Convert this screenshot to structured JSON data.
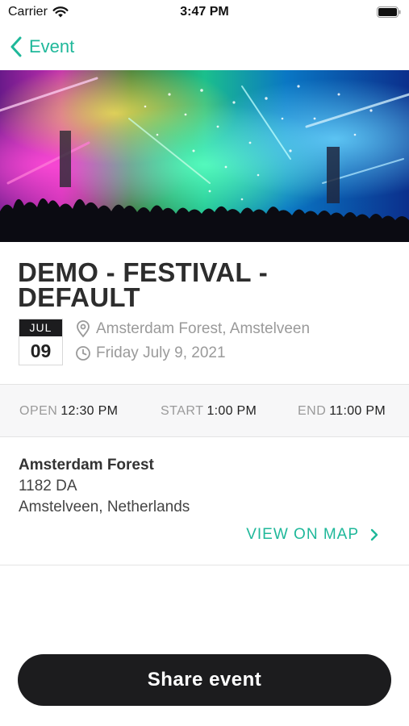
{
  "status_bar": {
    "carrier": "Carrier",
    "time": "3:47 PM"
  },
  "nav": {
    "back_label": "Event"
  },
  "event": {
    "title": "DEMO - FESTIVAL - DEFAULT",
    "date_month": "JUL",
    "date_day": "09",
    "location": "Amsterdam Forest, Amstelveen",
    "date_full": "Friday July 9, 2021"
  },
  "times": {
    "open_label": "OPEN",
    "open_value": "12:30 PM",
    "start_label": "START",
    "start_value": "1:00 PM",
    "end_label": "END",
    "end_value": "11:00 PM"
  },
  "address": {
    "name": "Amsterdam Forest",
    "line1": "1182 DA",
    "line2": "Amstelveen, Netherlands",
    "map_link": "VIEW ON MAP"
  },
  "actions": {
    "share_label": "Share event"
  },
  "colors": {
    "accent": "#1fb89a",
    "dark": "#1c1c1e"
  }
}
